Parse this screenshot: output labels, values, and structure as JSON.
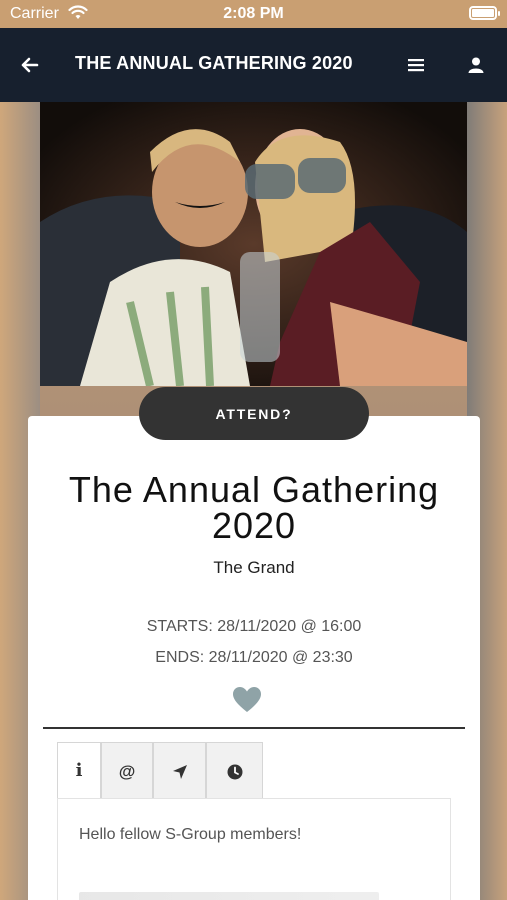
{
  "status_bar": {
    "carrier": "Carrier",
    "time": "2:08 PM",
    "icons": [
      "wifi-icon",
      "battery-icon"
    ]
  },
  "nav": {
    "title": "THE ANNUAL GATHERING 2020",
    "icons": [
      "back-arrow-icon",
      "hamburger-menu-icon",
      "user-icon"
    ]
  },
  "event": {
    "attend_label": "ATTEND?",
    "title": "The Annual Gathering 2020",
    "venue": "The Grand",
    "starts": "STARTS: 28/11/2020 @ 16:00",
    "ends": "ENDS: 28/11/2020 @ 23:30"
  },
  "tabs": [
    {
      "icon": "info-icon",
      "glyph": "i",
      "active": true
    },
    {
      "icon": "at-icon",
      "glyph": "@",
      "active": false
    },
    {
      "icon": "location-arrow-icon",
      "glyph": "",
      "active": false
    },
    {
      "icon": "clock-icon",
      "glyph": "",
      "active": false
    }
  ],
  "info": {
    "greeting": "Hello fellow S-Group members!"
  },
  "colors": {
    "nav_bg": "#17202e",
    "status_bg": "#c99f72",
    "attend_bg": "#333333",
    "heart": "#8fa3a7",
    "active_tab_underline": "#a8cc8c"
  }
}
